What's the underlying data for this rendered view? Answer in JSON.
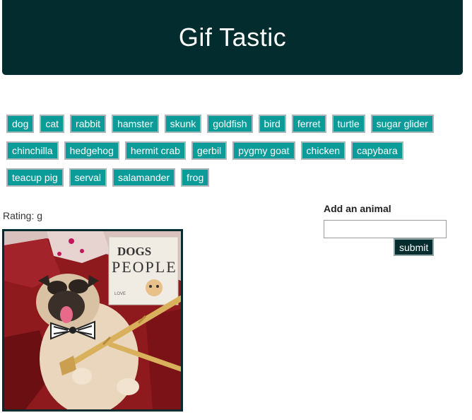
{
  "header": {
    "title": "Gif Tastic"
  },
  "animals": [
    "dog",
    "cat",
    "rabbit",
    "hamster",
    "skunk",
    "goldfish",
    "bird",
    "ferret",
    "turtle",
    "sugar glider",
    "chinchilla",
    "hedgehog",
    "hermit crab",
    "gerbil",
    "pygmy goat",
    "chicken",
    "capybara",
    "teacup pig",
    "serval",
    "salamander",
    "frog"
  ],
  "results": [
    {
      "rating_text": "Rating: g",
      "image": "pug-lying-with-bowtie-gif"
    }
  ],
  "form": {
    "label": "Add an animal",
    "input_value": "",
    "submit_label": "submit"
  },
  "colors": {
    "header_bg": "#022c2d",
    "button_bg": "#0b9b98",
    "button_border": "#a8b8b8",
    "submit_bg": "#022c2d"
  }
}
